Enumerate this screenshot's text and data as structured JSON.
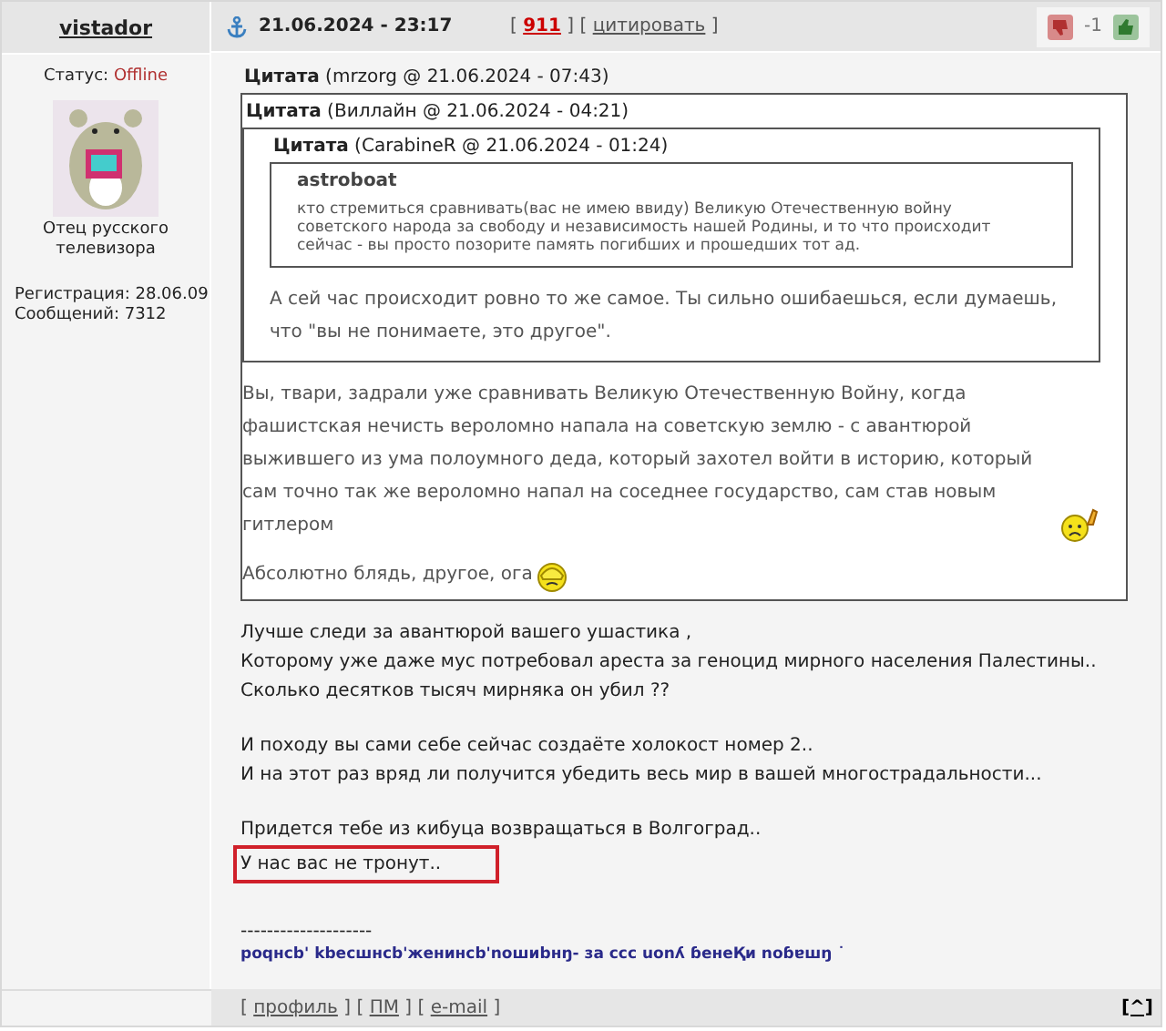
{
  "author": {
    "name": "vistador",
    "status_label": "Статус:",
    "status": "Offline",
    "online": false,
    "title": "Отец русского телевизора",
    "registration": "Регистрация: 28.06.09",
    "posts": "Сообщений: 7312"
  },
  "header": {
    "datetime": "21.06.2024 - 23:17",
    "number": {
      "open": "[",
      "label": "911",
      "close": "]"
    },
    "quote_link": {
      "open": "[",
      "label": "цитировать",
      "close": "]"
    },
    "rating": "-1"
  },
  "quote": {
    "label": "Цитата",
    "meta": "(mrzorg @ 21.06.2024 - 07:43)",
    "quote": {
      "label": "Цитата",
      "meta": "(Виллайн @ 21.06.2024 - 04:21)",
      "quote": {
        "label": "Цитата",
        "meta": "(CarabineR @ 21.06.2024 - 01:24)",
        "paragraphs": [
          {
            "kind": "heading",
            "text": "astroboat"
          },
          {
            "kind": "small",
            "text": "кто стремиться сравнивать(вас не имею ввиду) Великую Отечественную войну советского народа за свободу и независимость нашей Родины, и то что происходит сейчас - вы просто позорите память погибших и прошедших тот ад."
          }
        ]
      },
      "paragraphs": [
        {
          "kind": "text",
          "text": "А сей час происходит ровно то же самое. Ты сильно ошибаешься, если думаешь, что \"вы не понимаете, это другое\"."
        }
      ]
    },
    "paragraphs": [
      {
        "kind": "text",
        "text": "Вы, твари, задрали уже сравнивать Великую Отечественную Войну, когда фашистская нечисть вероломно напала на советскую землю - с авантюрой выжившего из ума полоумного деда, который захотел войти в историю, который сам точно так же вероломно напал на соседнее государство, сам став новым гитлером",
        "smiley": {
          "kind": "pointing"
        }
      },
      {
        "kind": "text",
        "text": "Абсолютно блядь, другое, ога",
        "smiley": {
          "kind": "facepalm"
        }
      }
    ]
  },
  "body": [
    [
      {
        "text": "Лучше следи за авантюрой вашего ушастика ,",
        "highlighted": false
      },
      {
        "text": "Которому уже даже мус потребовал ареста за геноцид мирного населения Палестины..",
        "highlighted": false
      },
      {
        "text": "Сколько десятков тысяч мирняка он убил ??",
        "highlighted": false
      }
    ],
    [
      {
        "text": "И походу вы сами себе сейчас создаёте холокост номер 2..",
        "highlighted": false
      },
      {
        "text": "И на этот раз вряд ли получится убедить весь мир в вашей многострадальности...",
        "highlighted": false
      }
    ],
    [
      {
        "text": "Придется тебе из кибуца возвращаться в Волгоград..",
        "highlighted": false
      },
      {
        "text": "У нас вас не тронут..",
        "highlighted": true
      }
    ]
  ],
  "signature": {
    "rule": "--------------------",
    "text": "poqнcb' kbecшнcb'жeнинcb'noшиbнŋ- зa ccc uonʎ ɓeнeҚи noɓɐшŋ ˙"
  },
  "footer": {
    "links": [
      {
        "open": "[",
        "label": "профиль",
        "close": "]"
      },
      {
        "open": "[",
        "label": "ПМ",
        "close": "]"
      },
      {
        "open": "[",
        "label": "e-mail",
        "close": "]"
      }
    ],
    "top": "[^]"
  }
}
